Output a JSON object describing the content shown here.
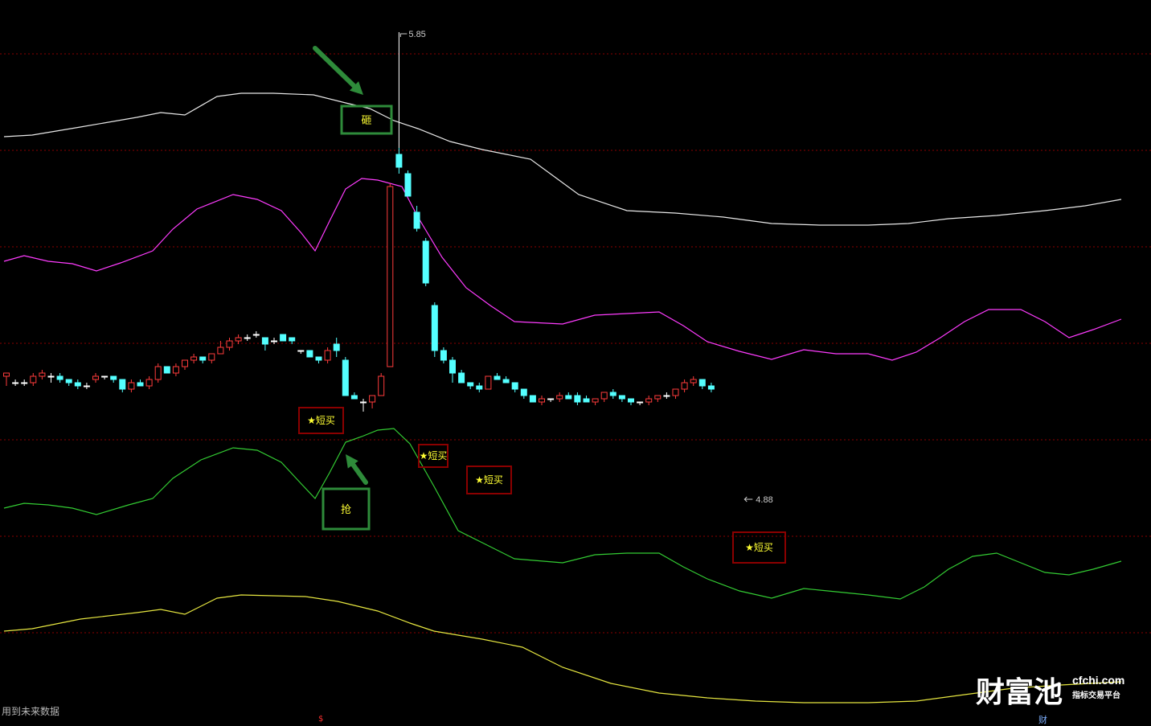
{
  "chart_data": {
    "type": "candlestick",
    "price_labels": {
      "high": "5.85",
      "low": "4.88"
    },
    "footer": "用到未来数据",
    "watermark": {
      "cn": "财富池",
      "url": "cfchi.com",
      "sub": "指标交易平台"
    },
    "bottom_marks": [
      "$",
      "财"
    ],
    "signals": [
      {
        "label": "★短买",
        "bar": 32,
        "price": 4.96
      },
      {
        "label": "★短买",
        "bar": 43,
        "price": 4.95
      },
      {
        "label": "★短买",
        "bar": 49,
        "price": 4.92
      },
      {
        "label": "★短买",
        "bar": 78,
        "price": 4.8
      }
    ],
    "callouts": [
      {
        "label": "砸",
        "bar": 38,
        "price": 5.71
      },
      {
        "label": "抢",
        "bar": 35,
        "price": 4.87
      }
    ],
    "colors": {
      "up": "#ff3b3b",
      "down": "#54ffff",
      "doji": "#ffffff",
      "band_top": "#e8e8e8",
      "band_upper": "#ff3cff",
      "band_lower": "#33cc33",
      "band_bottom": "#e6e640",
      "grid": "#8b0000",
      "signal_box": "#8b0000",
      "callout_box": "#2e8b3a",
      "arrow": "#2e8b3a",
      "signal_text": "#ffff33"
    },
    "candles": [
      [
        5.0,
        5.01,
        4.97,
        5.01
      ],
      [
        4.98,
        4.99,
        4.97,
        4.98
      ],
      [
        4.98,
        4.99,
        4.97,
        4.98
      ],
      [
        4.98,
        5.01,
        4.97,
        5.0
      ],
      [
        5.0,
        5.02,
        4.99,
        5.01
      ],
      [
        5.0,
        5.01,
        4.98,
        5.0
      ],
      [
        5.0,
        5.01,
        4.98,
        4.99
      ],
      [
        4.99,
        4.99,
        4.97,
        4.98
      ],
      [
        4.98,
        4.99,
        4.96,
        4.97
      ],
      [
        4.97,
        4.98,
        4.96,
        4.97
      ],
      [
        4.99,
        5.01,
        4.98,
        5.0
      ],
      [
        5.0,
        5.0,
        4.99,
        5.0
      ],
      [
        5.0,
        5.0,
        4.98,
        4.99
      ],
      [
        4.99,
        4.99,
        4.95,
        4.96
      ],
      [
        4.96,
        4.99,
        4.95,
        4.98
      ],
      [
        4.98,
        4.99,
        4.97,
        4.97
      ],
      [
        4.97,
        5.0,
        4.96,
        4.99
      ],
      [
        4.99,
        5.04,
        4.98,
        5.03
      ],
      [
        5.03,
        5.03,
        5.01,
        5.01
      ],
      [
        5.01,
        5.04,
        5.0,
        5.03
      ],
      [
        5.03,
        5.05,
        5.02,
        5.05
      ],
      [
        5.05,
        5.07,
        5.04,
        5.06
      ],
      [
        5.06,
        5.06,
        5.04,
        5.05
      ],
      [
        5.05,
        5.07,
        5.04,
        5.07
      ],
      [
        5.07,
        5.11,
        5.07,
        5.09
      ],
      [
        5.09,
        5.12,
        5.08,
        5.11
      ],
      [
        5.11,
        5.13,
        5.1,
        5.12
      ],
      [
        5.12,
        5.13,
        5.11,
        5.12
      ],
      [
        5.13,
        5.14,
        5.12,
        5.13
      ],
      [
        5.12,
        5.12,
        5.08,
        5.1
      ],
      [
        5.11,
        5.12,
        5.1,
        5.11
      ],
      [
        5.13,
        5.13,
        5.11,
        5.11
      ],
      [
        5.12,
        5.12,
        5.1,
        5.11
      ],
      [
        5.08,
        5.08,
        5.07,
        5.08
      ],
      [
        5.08,
        5.08,
        5.06,
        5.06
      ],
      [
        5.06,
        5.06,
        5.04,
        5.05
      ],
      [
        5.05,
        5.09,
        5.04,
        5.08
      ],
      [
        5.1,
        5.12,
        5.06,
        5.08
      ],
      [
        5.05,
        5.06,
        4.94,
        4.94
      ],
      [
        4.94,
        4.95,
        4.93,
        4.93
      ],
      [
        4.92,
        4.93,
        4.89,
        4.92
      ],
      [
        4.92,
        4.94,
        4.9,
        4.94
      ],
      [
        4.94,
        5.01,
        4.94,
        5.0
      ],
      [
        5.03,
        5.6,
        5.03,
        5.59
      ],
      [
        5.69,
        5.71,
        5.63,
        5.65
      ],
      [
        5.63,
        5.64,
        5.56,
        5.56
      ],
      [
        5.51,
        5.53,
        5.45,
        5.46
      ],
      [
        5.42,
        5.43,
        5.28,
        5.29
      ],
      [
        5.22,
        5.23,
        5.06,
        5.08
      ],
      [
        5.08,
        5.09,
        5.04,
        5.05
      ],
      [
        5.05,
        5.06,
        4.98,
        5.01
      ],
      [
        5.01,
        5.02,
        4.98,
        4.98
      ],
      [
        4.98,
        4.98,
        4.96,
        4.97
      ],
      [
        4.97,
        4.98,
        4.95,
        4.96
      ],
      [
        4.96,
        5.0,
        4.96,
        5.0
      ],
      [
        5.0,
        5.01,
        4.99,
        4.99
      ],
      [
        4.99,
        5.0,
        4.98,
        4.98
      ],
      [
        4.98,
        4.98,
        4.95,
        4.96
      ],
      [
        4.96,
        4.96,
        4.93,
        4.94
      ],
      [
        4.94,
        4.94,
        4.92,
        4.92
      ],
      [
        4.92,
        4.94,
        4.91,
        4.93
      ],
      [
        4.93,
        4.93,
        4.92,
        4.93
      ],
      [
        4.93,
        4.95,
        4.92,
        4.94
      ],
      [
        4.94,
        4.95,
        4.93,
        4.93
      ],
      [
        4.94,
        4.95,
        4.91,
        4.92
      ],
      [
        4.93,
        4.94,
        4.92,
        4.92
      ],
      [
        4.92,
        4.93,
        4.91,
        4.93
      ],
      [
        4.93,
        4.95,
        4.92,
        4.95
      ],
      [
        4.95,
        4.96,
        4.93,
        4.94
      ],
      [
        4.94,
        4.94,
        4.92,
        4.93
      ],
      [
        4.93,
        4.93,
        4.91,
        4.92
      ],
      [
        4.92,
        4.92,
        4.91,
        4.92
      ],
      [
        4.92,
        4.94,
        4.91,
        4.93
      ],
      [
        4.93,
        4.94,
        4.92,
        4.94
      ],
      [
        4.94,
        4.95,
        4.93,
        4.94
      ],
      [
        4.94,
        4.96,
        4.93,
        4.96
      ],
      [
        4.96,
        4.99,
        4.95,
        4.98
      ],
      [
        4.98,
        5.0,
        4.97,
        4.99
      ],
      [
        4.99,
        4.99,
        4.96,
        4.97
      ],
      [
        4.97,
        4.98,
        4.95,
        4.96
      ]
    ]
  }
}
